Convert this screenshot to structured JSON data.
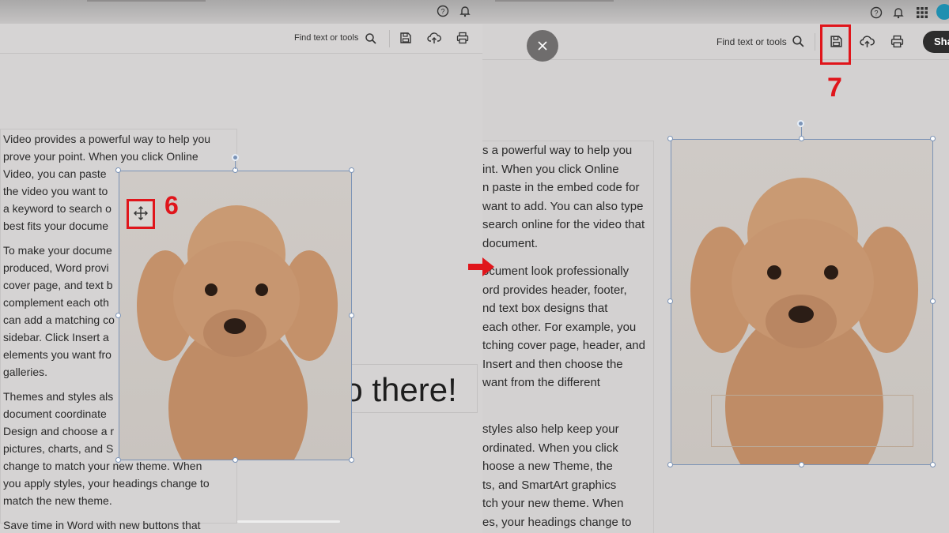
{
  "left_panel": {
    "toolbar": {
      "find_text": "Find text or tools"
    },
    "icons": [
      "help-icon",
      "bell-icon",
      "search-icon",
      "save-icon",
      "cloud-upload-icon",
      "print-icon",
      "move-icon"
    ],
    "paragraphs": [
      [
        "Video provides a powerful way to help you",
        "prove your point. When you click Online",
        "Video, you can paste",
        "the video you want to",
        "a keyword to search o",
        "best fits your docume"
      ],
      [
        "To make your docume",
        "produced, Word provi",
        "cover page, and text b",
        "complement each oth",
        "can add a matching co",
        "sidebar. Click Insert a",
        "elements you want fro",
        "galleries."
      ],
      [
        "Themes and styles als",
        "document coordinate",
        "Design and choose a r",
        "pictures, charts, and S",
        "change to match your new theme. When",
        "you apply styles, your headings change to",
        "match the new theme."
      ],
      [
        "Save time in Word with new buttons that"
      ]
    ],
    "heading_text": "lo there!",
    "step_label": "6"
  },
  "arrow_label": "➔",
  "right_panel": {
    "toolbar": {
      "find_text": "Find text or tools",
      "share_label": "Sha"
    },
    "icons": [
      "help-icon",
      "bell-icon",
      "apps-grid-icon",
      "close-icon",
      "search-icon",
      "save-icon",
      "cloud-upload-icon",
      "print-icon"
    ],
    "paragraphs": [
      [
        "s a powerful way to help you",
        "int. When you click Online",
        "n paste in the embed code for",
        "want to add. You can also type",
        "search online for the video that",
        "document."
      ],
      [
        "ocument look professionally",
        "ord provides header, footer,",
        "nd text box designs that",
        "each other. For example, you",
        "tching cover page, header, and",
        "Insert and then choose the",
        "want from the different"
      ],
      [
        "styles also help keep your",
        "ordinated. When you click",
        "hoose a new Theme, the",
        "ts, and SmartArt graphics",
        "tch your new theme. When",
        "es, your headings change to"
      ]
    ],
    "step_label": "7"
  },
  "colors": {
    "highlight_red": "#e0151b",
    "selection_blue": "#7b93b6",
    "avatar_teal": "#1f8fb0"
  }
}
